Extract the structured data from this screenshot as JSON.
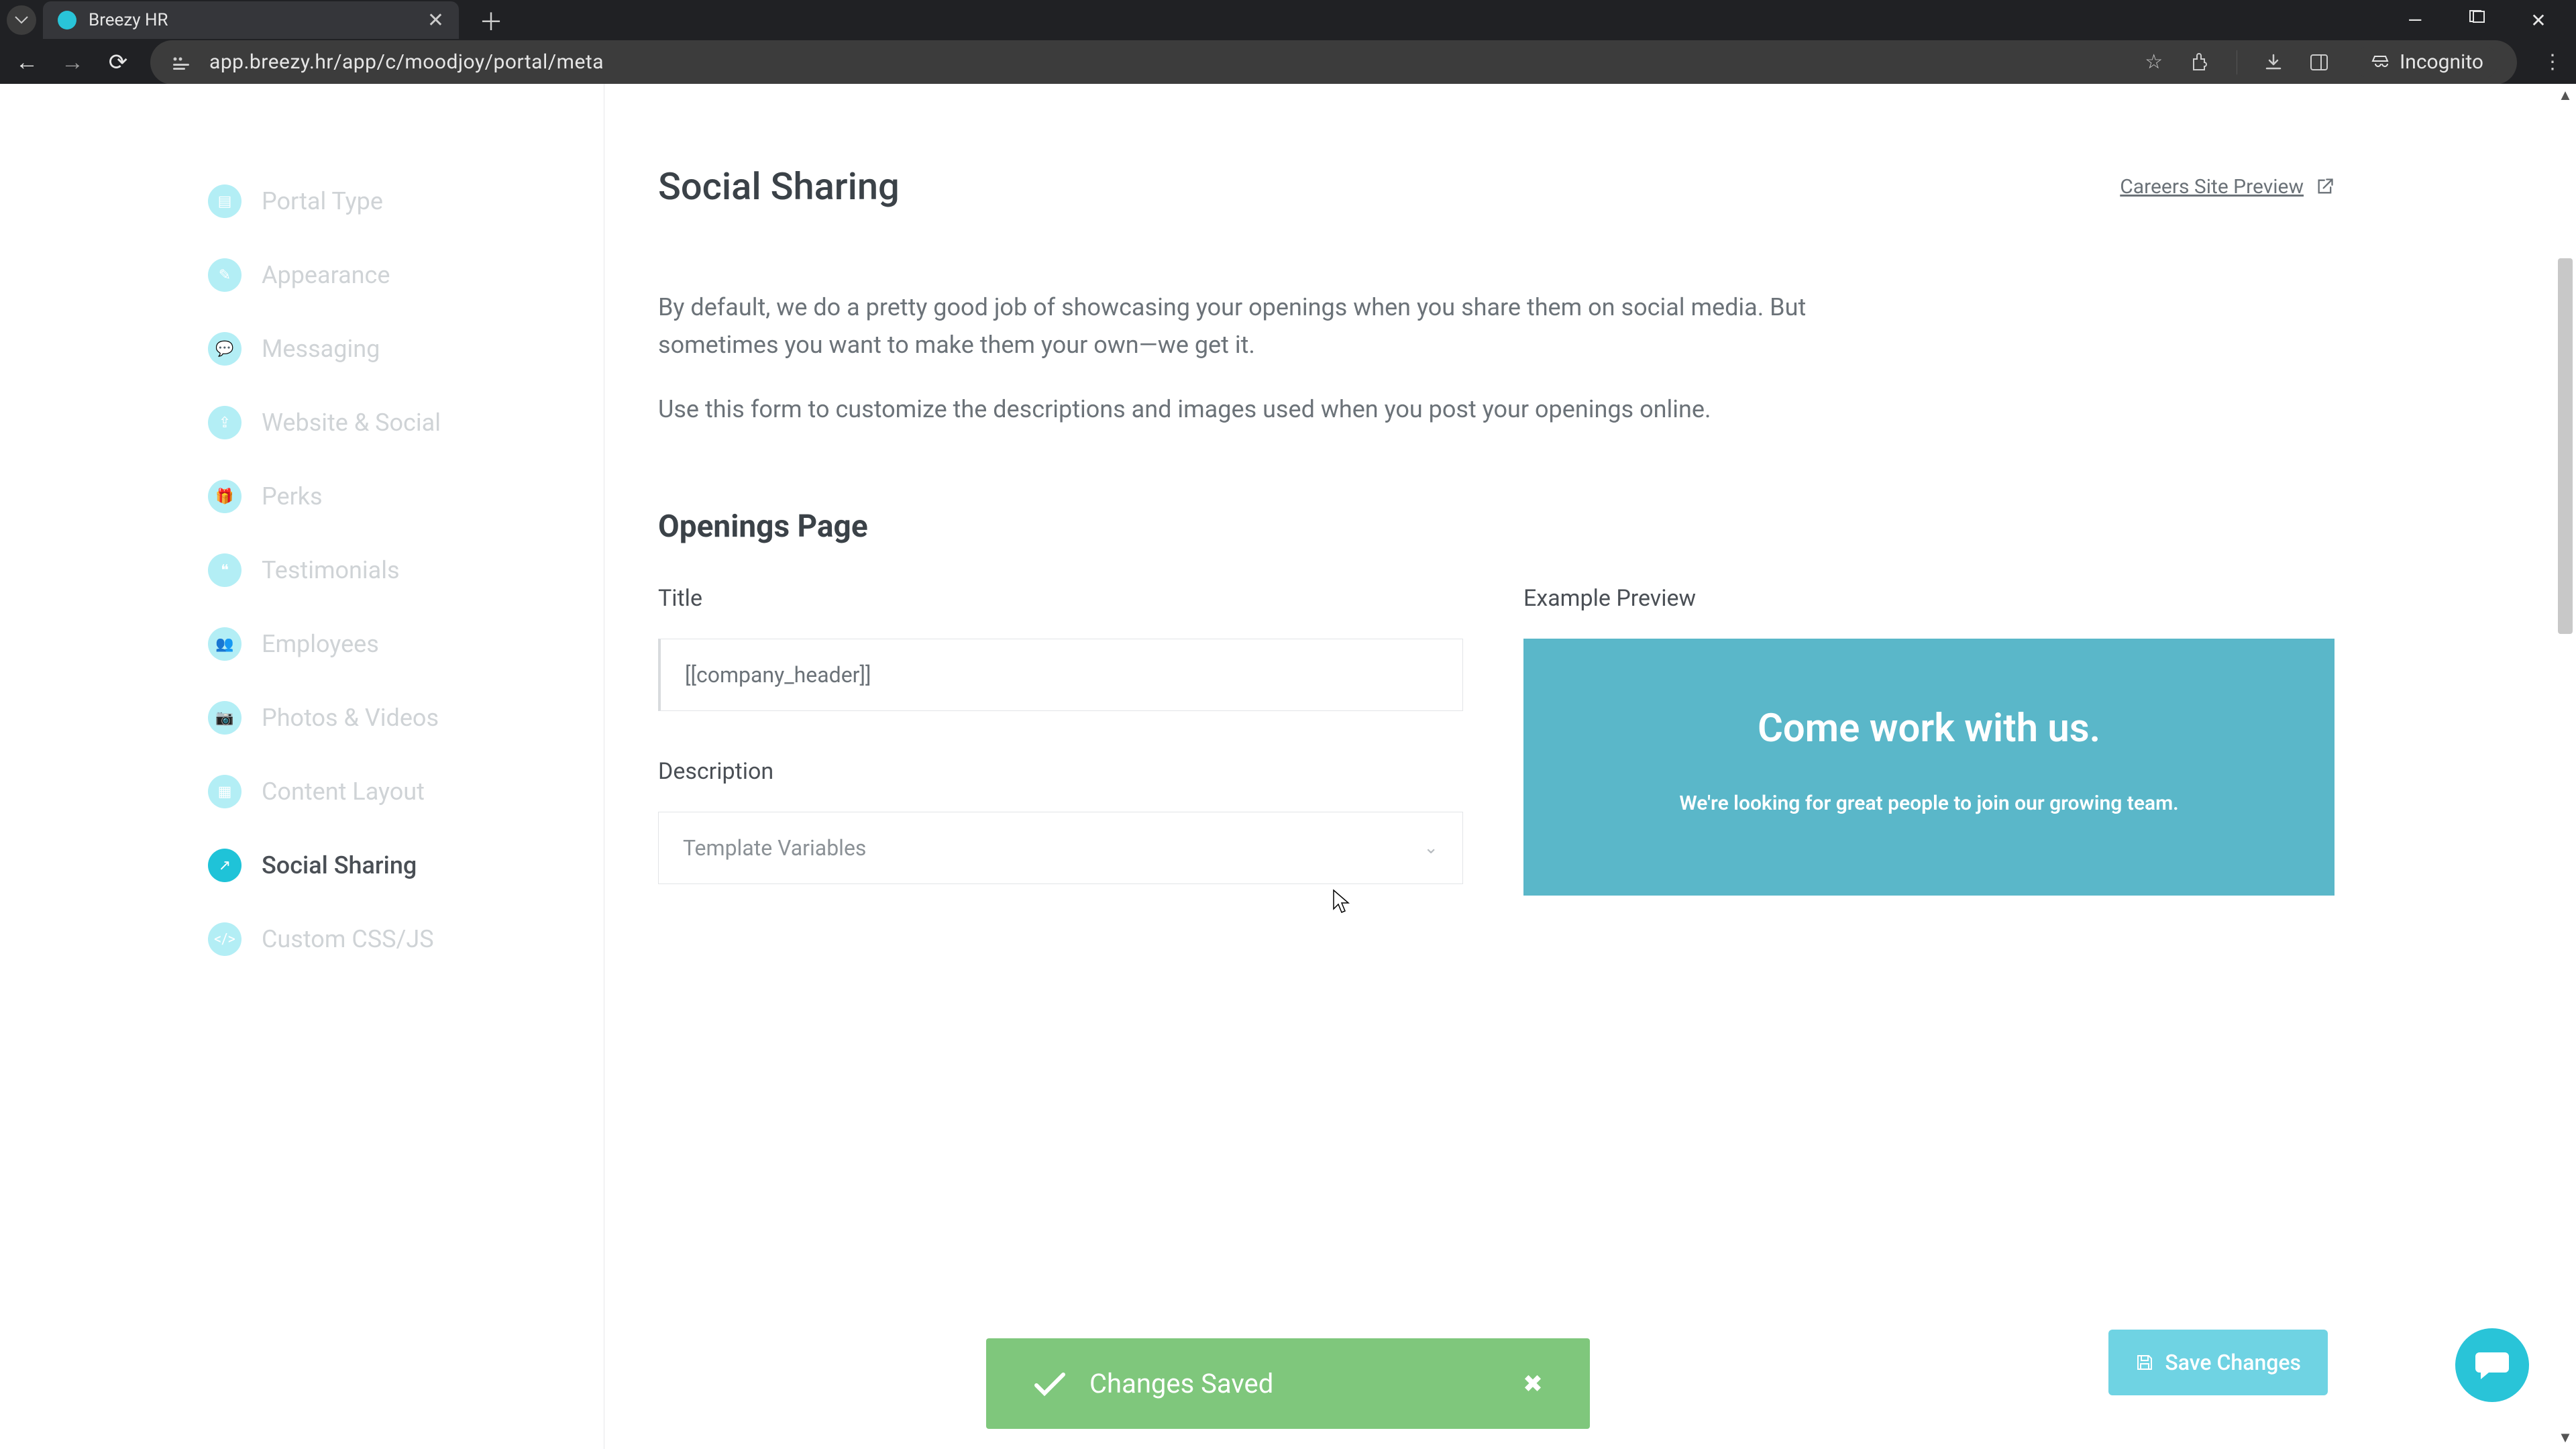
{
  "browser": {
    "tab_title": "Breezy HR",
    "url": "app.breezy.hr/app/c/moodjoy/portal/meta",
    "incognito_label": "Incognito"
  },
  "sidebar": {
    "items": [
      {
        "label": "Portal Type",
        "icon": "document-icon",
        "active": false
      },
      {
        "label": "Appearance",
        "icon": "pencil-icon",
        "active": false
      },
      {
        "label": "Messaging",
        "icon": "chat-icon",
        "active": false
      },
      {
        "label": "Website & Social",
        "icon": "share-icon",
        "active": false
      },
      {
        "label": "Perks",
        "icon": "gift-icon",
        "active": false
      },
      {
        "label": "Testimonials",
        "icon": "quote-icon",
        "active": false
      },
      {
        "label": "Employees",
        "icon": "people-icon",
        "active": false
      },
      {
        "label": "Photos & Videos",
        "icon": "camera-icon",
        "active": false
      },
      {
        "label": "Content Layout",
        "icon": "layout-icon",
        "active": false
      },
      {
        "label": "Social Sharing",
        "icon": "share-alt-icon",
        "active": true
      },
      {
        "label": "Custom CSS/JS",
        "icon": "code-icon",
        "active": false
      }
    ]
  },
  "header": {
    "title": "Social Sharing",
    "preview_link": "Careers Site Preview"
  },
  "intro": {
    "p1": "By default, we do a pretty good job of showcasing your openings when you share them on social media. But sometimes you want to make them your own—we get it.",
    "p2": "Use this form to customize the descriptions and images used when you post your openings online."
  },
  "openings": {
    "section_title": "Openings Page",
    "title_label": "Title",
    "title_value": "[[company_header]]",
    "desc_label": "Description",
    "desc_select": "Template Variables",
    "preview_label": "Example Preview",
    "preview_heading": "Come work with us.",
    "preview_sub": "We're looking for great people to join our growing team."
  },
  "toast": {
    "label": "Changes Saved"
  },
  "save_button": "Save Changes",
  "colors": {
    "accent": "#29c4d8",
    "preview_bg": "#5ab7c9",
    "toast_bg": "#7fc77c"
  }
}
